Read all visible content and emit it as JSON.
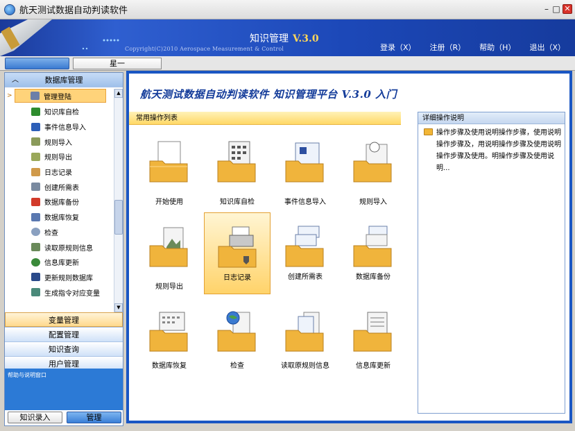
{
  "window": {
    "title": "航天测试数据自动判读软件",
    "buttons": [
      "–",
      "□",
      "✕"
    ]
  },
  "banner": {
    "title": "知识管理",
    "version": "V.3.0",
    "copyright": "Copyright(C)2010 Aerospace Measurement & Control",
    "links": [
      "登录（X）",
      "注册（R）",
      "帮助（H）",
      "退出（X）"
    ]
  },
  "tabs": {
    "star_label": "星一"
  },
  "sidebar": {
    "header": "数据库管理",
    "items": [
      {
        "label": "管理登陆",
        "icon": "user-key-icon",
        "color": "#6b7fa8"
      },
      {
        "label": "知识库自检",
        "icon": "flag-icon",
        "color": "#2e8c2e"
      },
      {
        "label": "事件信息导入",
        "icon": "arrow-right-icon",
        "color": "#2d5fb8"
      },
      {
        "label": "规则导入",
        "icon": "image-import-icon",
        "color": "#8a9a5a"
      },
      {
        "label": "规则导出",
        "icon": "image-export-icon",
        "color": "#9aa85a"
      },
      {
        "label": "日志记录",
        "icon": "log-icon",
        "color": "#d09a4a"
      },
      {
        "label": "创建所需表",
        "icon": "create-table-icon",
        "color": "#7a8aa0"
      },
      {
        "label": "数据库备份",
        "icon": "backup-icon",
        "color": "#d23a2a"
      },
      {
        "label": "数据库恢复",
        "icon": "restore-icon",
        "color": "#5a78b0"
      },
      {
        "label": "检查",
        "icon": "magnifier-icon",
        "color": "#8aa0c0"
      },
      {
        "label": "读取原规则信息",
        "icon": "read-rule-icon",
        "color": "#6a8a5a"
      },
      {
        "label": "信息库更新",
        "icon": "globe-icon",
        "color": "#3a8a3a"
      },
      {
        "label": "更新规则数据库",
        "icon": "book-icon",
        "color": "#2a4a8a"
      },
      {
        "label": "生成指令对应变量",
        "icon": "generate-icon",
        "color": "#4a8a7a"
      }
    ],
    "groups": [
      "变量管理",
      "配置管理",
      "知识查询",
      "用户管理"
    ],
    "help_text": "帮助与说明窗口",
    "bottom_buttons": [
      "知识录入",
      "管理"
    ]
  },
  "main": {
    "title": "航天测试数据自动判读软件  知识管理平台 V.3.0 入门",
    "ops_title": "常用操作列表",
    "tiles": [
      {
        "label": "开始使用",
        "icon": "document-folder-icon"
      },
      {
        "label": "知识库自检",
        "icon": "grid-folder-icon"
      },
      {
        "label": "事件信息导入",
        "icon": "screen-folder-icon"
      },
      {
        "label": "规则导入",
        "icon": "mail-folder-icon"
      },
      {
        "label": "规则导出",
        "icon": "image-folder-icon"
      },
      {
        "label": "日志记录",
        "icon": "printer-folder-icon"
      },
      {
        "label": "创建所需表",
        "icon": "windows-folder-icon"
      },
      {
        "label": "数据库备份",
        "icon": "stack-folder-icon"
      },
      {
        "label": "数据库恢复",
        "icon": "calendar-folder-icon"
      },
      {
        "label": "检查",
        "icon": "globe-folder-icon"
      },
      {
        "label": "读取原规则信息",
        "icon": "docs-folder-icon"
      },
      {
        "label": "信息库更新",
        "icon": "news-folder-icon"
      }
    ],
    "detail": {
      "title": "详细操作说明",
      "text": "操作步骤及使用说明操作步骤，使用说明操作步骤及，用说明操作步骤及使用说明操作步骤及使用。明操作步骤及使用说明..."
    }
  }
}
